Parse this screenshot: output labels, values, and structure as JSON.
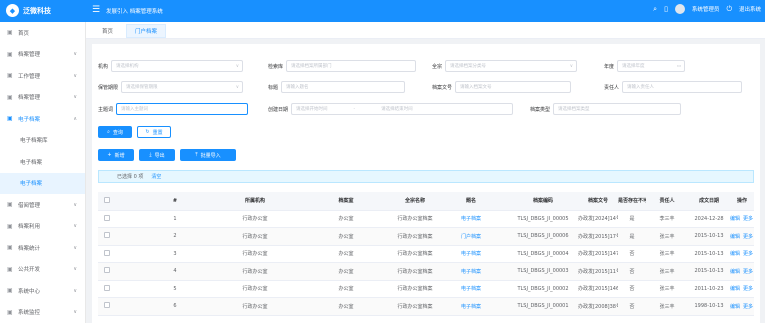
{
  "header": {
    "logo": "泛微科技",
    "system_title": "发展引入 档案管理系统",
    "user": "系统管理员",
    "exit": "退出系统"
  },
  "sidebar": {
    "items": [
      {
        "label": "首页",
        "icon": "home-icon",
        "arrow": false
      },
      {
        "label": "档案管理",
        "icon": "archive-icon",
        "arrow": true
      },
      {
        "label": "工作管理",
        "icon": "work-icon",
        "arrow": true
      },
      {
        "label": "档案管理",
        "icon": "folder-icon",
        "arrow": true
      },
      {
        "label": "电子档案",
        "icon": "document-icon",
        "arrow": true,
        "open": true
      },
      {
        "label": "电子档案库",
        "sub": true
      },
      {
        "label": "电子档案",
        "sub": true
      },
      {
        "label": "电子档案",
        "sub": true,
        "active": true
      },
      {
        "label": "借阅管理",
        "icon": "borrow-icon",
        "arrow": true
      },
      {
        "label": "档案利用",
        "icon": "use-icon",
        "arrow": true
      },
      {
        "label": "档案统计",
        "icon": "stats-icon",
        "arrow": true
      },
      {
        "label": "公共开发",
        "icon": "dev-icon",
        "arrow": true
      },
      {
        "label": "系统中心",
        "icon": "system-icon",
        "arrow": true
      },
      {
        "label": "系统监控",
        "icon": "monitor-icon",
        "arrow": true
      }
    ]
  },
  "tabs": [
    "首页",
    "门户档案"
  ],
  "filters": {
    "org": {
      "label": "机构",
      "placeholder": "请选择机构"
    },
    "dept": {
      "label": "检索库",
      "placeholder": "请选择档案所属部门"
    },
    "category": {
      "label": "全宗",
      "placeholder": "请选择档案分类号"
    },
    "year": {
      "label": "年度",
      "placeholder": "请选择年度"
    },
    "manage": {
      "label": "保管期限",
      "placeholder": "请选择保管期限"
    },
    "title": {
      "label": "标题",
      "placeholder": "请输入题名"
    },
    "docno": {
      "label": "档案文号",
      "placeholder": "请输入档案文号"
    },
    "person": {
      "label": "责任人",
      "placeholder": "请输入责任人"
    },
    "keyword": {
      "label": "主题词",
      "placeholder": "请输入主题词"
    },
    "date": {
      "label": "创建日期",
      "start": "请选择开始时间",
      "sep": "-",
      "end": "请选择结束时间"
    },
    "type": {
      "label": "档案类型",
      "placeholder": "请选择档案类型"
    }
  },
  "buttons": {
    "search": "查询",
    "reset": "重置",
    "add": "新增",
    "export": "导出",
    "batch_import": "批量导入"
  },
  "alert": {
    "selected": "已选择 0 项",
    "clear": "清空"
  },
  "table": {
    "columns": [
      "#",
      "所属机构",
      "档案室",
      "全宗名称",
      "题名",
      "档案编码",
      "档案文号",
      "是否存在不可归档",
      "责任人",
      "成文日期",
      "操作"
    ],
    "rows": [
      [
        "1",
        "行政办公室",
        "办公室",
        "行政办公室档案",
        "电子档案",
        "TLSJ_DBGS_JI_00005",
        "办政发[2024]14号",
        "是",
        "李三丰",
        "2024-12-28"
      ],
      [
        "2",
        "行政办公室",
        "办公室",
        "行政办公室档案",
        "门户档案",
        "TLSJ_DBGS_JI_00006",
        "办政发[2015]17号",
        "是",
        "张三丰",
        "2015-10-13"
      ],
      [
        "3",
        "行政办公室",
        "办公室",
        "行政办公室档案",
        "电子档案",
        "TLSJ_DBGS_JI_00004",
        "办政发[2015]147号",
        "否",
        "张三丰",
        "2015-10-13"
      ],
      [
        "4",
        "行政办公室",
        "办公室",
        "行政办公室档案",
        "电子档案",
        "TLSJ_DBGS_JI_00003",
        "办政发[2015]11号",
        "否",
        "张三丰",
        "2015-10-13"
      ],
      [
        "5",
        "行政办公室",
        "办公室",
        "行政办公室档案",
        "电子档案",
        "TLSJ_DBGS_JI_00002",
        "办政发[2015]146号",
        "否",
        "张三丰",
        "2011-10-23"
      ],
      [
        "6",
        "行政办公室",
        "办公室",
        "行政办公室档案",
        "电子档案",
        "TLSJ_DBGS_JI_00001",
        "办政发[2008]38号",
        "否",
        "张三丰",
        "1998-10-13"
      ]
    ],
    "edit": "编辑",
    "more": "更多 ∨"
  }
}
